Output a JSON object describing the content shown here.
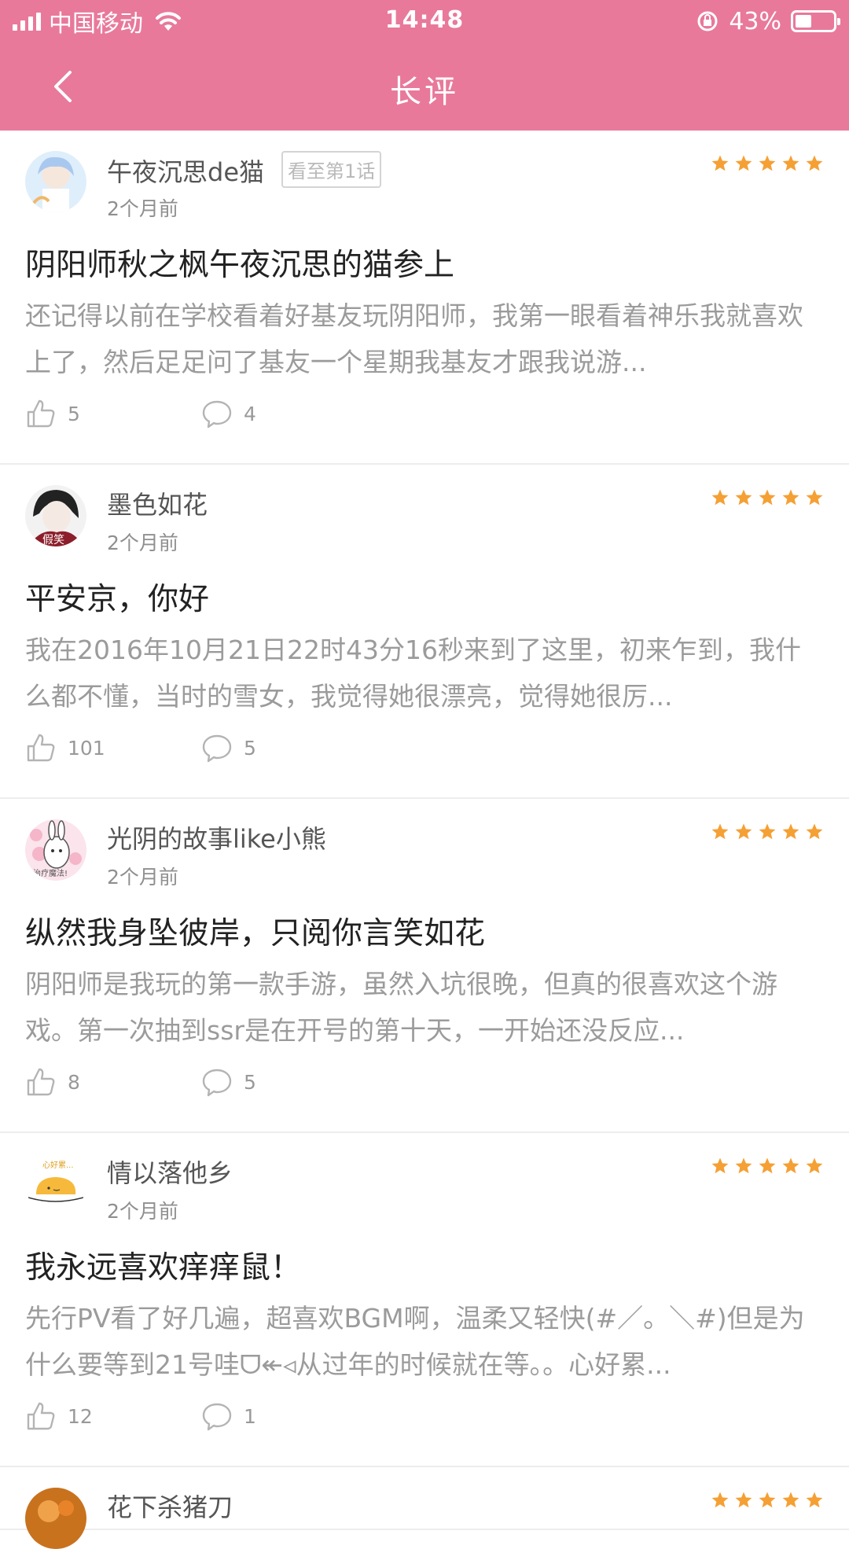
{
  "status_bar": {
    "carrier": "中国移动",
    "time": "14:48",
    "battery": "43%",
    "battery_level": 0.43
  },
  "nav": {
    "title": "长评",
    "back_icon": "chevron-left-icon"
  },
  "reviews": [
    {
      "username": "午夜沉思de猫",
      "progress_tag": "看至第1话",
      "time": "2个月前",
      "stars": 5,
      "title": "阴阳师秋之枫午夜沉思的猫参上",
      "excerpt": "还记得以前在学校看着好基友玩阴阳师，我第一眼看着神乐我就喜欢上了，然后足足问了基友一个星期我基友才跟我说游...",
      "likes": "5",
      "comments": "4"
    },
    {
      "username": "墨色如花",
      "progress_tag": "",
      "time": "2个月前",
      "stars": 5,
      "title": "平安京，你好",
      "excerpt": "我在2016年10月21日22时43分16秒来到了这里，初来乍到，我什么都不懂，当时的雪女，我觉得她很漂亮，觉得她很厉...",
      "likes": "101",
      "comments": "5",
      "avatar_text": "假笑"
    },
    {
      "username": "光阴的故事like小熊",
      "progress_tag": "",
      "time": "2个月前",
      "stars": 5,
      "title": "纵然我身坠彼岸，只阅你言笑如花",
      "excerpt": "阴阳师是我玩的第一款手游，虽然入坑很晚，但真的很喜欢这个游戏。第一次抽到ssr是在开号的第十天，一开始还没反应...",
      "likes": "8",
      "comments": "5",
      "avatar_text": "治疗魔法!"
    },
    {
      "username": "情以落他乡",
      "progress_tag": "",
      "time": "2个月前",
      "stars": 5,
      "title": "我永远喜欢痒痒鼠！",
      "excerpt": "先行PV看了好几遍，超喜欢BGM啊，温柔又轻快(#／。＼#)但是为什么要等到21号哇ᗜ↞◃从过年的时候就在等。。心好累...",
      "likes": "12",
      "comments": "1",
      "avatar_text": "心好累..."
    },
    {
      "username": "花下杀猪刀",
      "progress_tag": "",
      "time": "",
      "stars": 5,
      "title": "",
      "excerpt": "",
      "likes": "",
      "comments": ""
    }
  ],
  "colors": {
    "header": "#e8799b",
    "star": "#f5a034",
    "title_text": "#222222",
    "excerpt_text": "#9b9b9b"
  }
}
